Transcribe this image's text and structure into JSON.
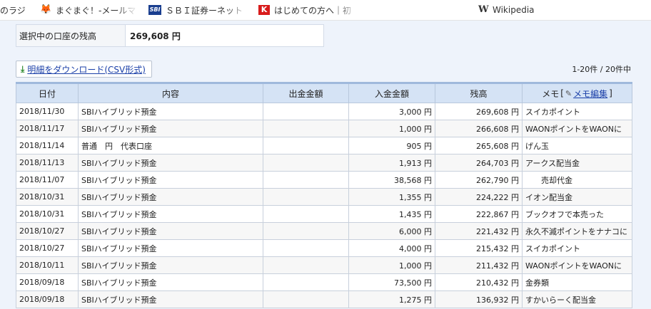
{
  "bookmarks": [
    {
      "label": "のラジ",
      "icon": "radio-icon"
    },
    {
      "label": "まぐまぐ！-メールマ",
      "icon": "mag2-fox-icon"
    },
    {
      "label": "ＳＢＩ証券ーネット",
      "icon": "sbi-icon"
    },
    {
      "label": "はじめての方へ｜初",
      "icon": "k-icon"
    },
    {
      "label": "Wikipedia",
      "icon": "wikipedia-icon"
    }
  ],
  "balance": {
    "label": "選択中の口座の残高",
    "value": "269,608 円"
  },
  "csv_button": {
    "label": "明細をダウンロード(CSV形式)"
  },
  "pagination": {
    "count": "1-20件 / 20件中"
  },
  "table": {
    "headers": {
      "date": "日付",
      "content": "内容",
      "withdrawal": "出金金額",
      "deposit": "入金金額",
      "balance": "残高",
      "memo": "メモ",
      "memo_edit": "メモ編集"
    },
    "rows": [
      {
        "date": "2018/11/30",
        "content": "SBIハイブリッド預金",
        "withdrawal": "",
        "deposit": "3,000 円",
        "balance": "269,608 円",
        "memo": "スイカポイント"
      },
      {
        "date": "2018/11/17",
        "content": "SBIハイブリッド預金",
        "withdrawal": "",
        "deposit": "1,000 円",
        "balance": "266,608 円",
        "memo": "WAONポイントをWAONに"
      },
      {
        "date": "2018/11/14",
        "content": "普通　円　代表口座",
        "withdrawal": "",
        "deposit": "905 円",
        "balance": "265,608 円",
        "memo": "げん玉"
      },
      {
        "date": "2018/11/13",
        "content": "SBIハイブリッド預金",
        "withdrawal": "",
        "deposit": "1,913 円",
        "balance": "264,703 円",
        "memo": "アークス配当金"
      },
      {
        "date": "2018/11/07",
        "content": "SBIハイブリッド預金",
        "withdrawal": "",
        "deposit": "38,568 円",
        "balance": "262,790 円",
        "memo": "　　売却代金"
      },
      {
        "date": "2018/10/31",
        "content": "SBIハイブリッド預金",
        "withdrawal": "",
        "deposit": "1,355 円",
        "balance": "224,222 円",
        "memo": "イオン配当金"
      },
      {
        "date": "2018/10/31",
        "content": "SBIハイブリッド預金",
        "withdrawal": "",
        "deposit": "1,435 円",
        "balance": "222,867 円",
        "memo": "ブックオフで本売った"
      },
      {
        "date": "2018/10/27",
        "content": "SBIハイブリッド預金",
        "withdrawal": "",
        "deposit": "6,000 円",
        "balance": "221,432 円",
        "memo": "永久不滅ポイントをナナコに"
      },
      {
        "date": "2018/10/27",
        "content": "SBIハイブリッド預金",
        "withdrawal": "",
        "deposit": "4,000 円",
        "balance": "215,432 円",
        "memo": "スイカポイント"
      },
      {
        "date": "2018/10/11",
        "content": "SBIハイブリッド預金",
        "withdrawal": "",
        "deposit": "1,000 円",
        "balance": "211,432 円",
        "memo": "WAONポイントをWAONに"
      },
      {
        "date": "2018/09/18",
        "content": "SBIハイブリッド預金",
        "withdrawal": "",
        "deposit": "73,500 円",
        "balance": "210,432 円",
        "memo": "金券類"
      },
      {
        "date": "2018/09/18",
        "content": "SBIハイブリッド預金",
        "withdrawal": "",
        "deposit": "1,275 円",
        "balance": "136,932 円",
        "memo": "すかいらーく配当金"
      }
    ]
  },
  "colors": {
    "content_bg": "#eef3fb",
    "header_bg": "#d5e3f5",
    "link": "#1a3fa8"
  }
}
